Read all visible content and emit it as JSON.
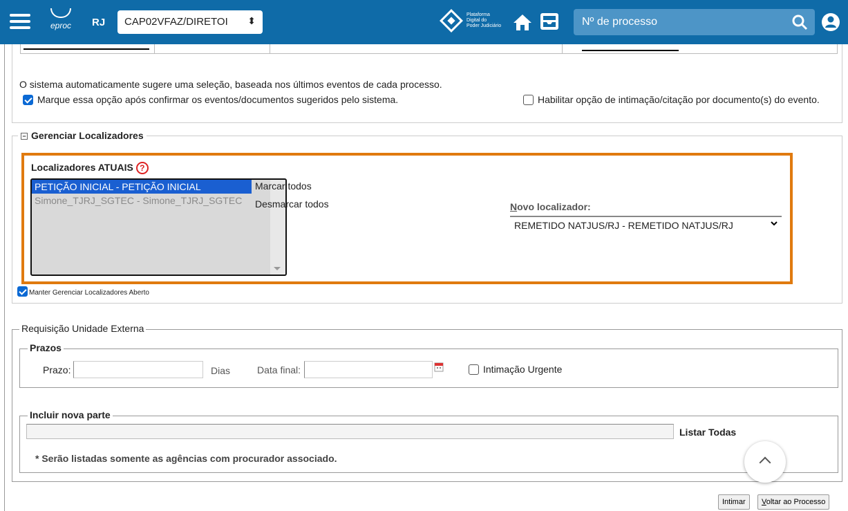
{
  "header": {
    "logo_text": "eproc",
    "uf": "RJ",
    "org_select_value": "CAP02VFAZ/DIRETOI",
    "pdpj_lines": [
      "Plataforma",
      "Digital do",
      "Poder Judiciário"
    ],
    "search_placeholder": "Nº de processo"
  },
  "options": {
    "auto_text": "O sistema automaticamente sugere uma seleção, baseada nos últimos eventos de cada processo.",
    "confirm_label": "Marque essa opção após confirmar os eventos/documentos sugeridos pelo sistema.",
    "confirm_checked": true,
    "enable_doc_label": "Habilitar opção de intimação/citação por documento(s) do evento.",
    "enable_doc_checked": false
  },
  "localizadores": {
    "section_title": "Gerenciar Localizadores",
    "current_title": "Localizadores ATUAIS",
    "help_symbol": "?",
    "items": [
      {
        "label": "PETIÇÃO INICIAL - PETIÇÃO INICIAL",
        "selected": true
      },
      {
        "label": "Simone_TJRJ_SGTEC - Simone_TJRJ_SGTEC",
        "selected": false
      }
    ],
    "mark_all": "Marcar todos",
    "unmark_all": "Desmarcar todos",
    "novo_label_accesskey": "N",
    "novo_label_rest": "ovo localizador:",
    "novo_value": "REMETIDO NATJUS/RJ - REMETIDO NATJUS/RJ",
    "keep_open_label": "Manter Gerenciar Localizadores Aberto",
    "keep_open_checked": true
  },
  "requisicao": {
    "title": "Requisição Unidade Externa",
    "prazos_title": "Prazos",
    "prazo_label": "Prazo:",
    "dias_label": "Dias",
    "data_final_label": "Data final:",
    "urgente_label": "Intimação Urgente",
    "urgente_checked": false,
    "nova_parte_title": "Incluir nova parte",
    "listar_label": "Listar Todas",
    "nota": "* Serão listadas somente as agências com procurador associado."
  },
  "actions": {
    "intimar": "Intimar",
    "voltar_accesskey": "V",
    "voltar_rest": "oltar ao Processo"
  },
  "colors": {
    "header_bg": "#0f6ba8",
    "highlight_border": "#e07a0f",
    "selected_item": "#1a5fd1",
    "checkbox": "#0b69d4"
  }
}
